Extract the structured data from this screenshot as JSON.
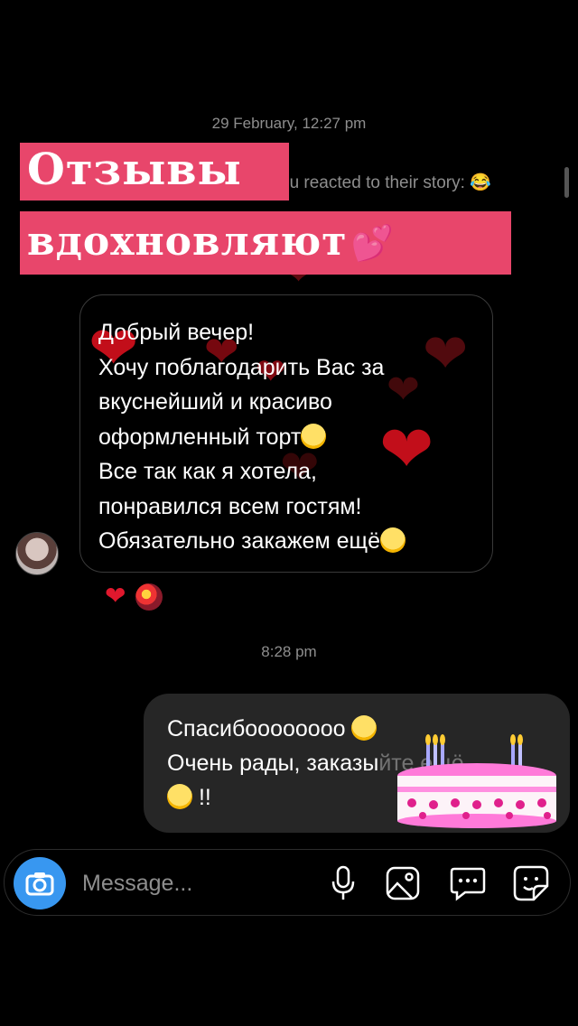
{
  "thread": {
    "date_stamp": "29 February, 12:27 pm",
    "reaction_note": "ou reacted to their story: 😂",
    "time_stamp": "8:28 pm"
  },
  "overlay": {
    "line1": "Отзывы",
    "line2": "вдохновляют",
    "color": "#e8466b"
  },
  "incoming_message": {
    "lines": [
      "Добрый вечер!",
      "Хочу поблагодарить Вас за",
      "вкуснейший и красиво",
      "оформленный торт",
      "Все так как я хотела,",
      "понравился всем гостям!",
      "Обязательно закажем ещё"
    ],
    "reactions": [
      "heart",
      "sticker"
    ]
  },
  "outgoing_message": {
    "line1": "Спасибоооооооо",
    "line2": "Очень рады, заказы",
    "line2_tail": "йте ещё",
    "line3": "!!"
  },
  "composer": {
    "placeholder": "Message...",
    "icons": [
      "camera-icon",
      "microphone-icon",
      "gallery-icon",
      "chat-bubble-icon",
      "sticker-icon"
    ],
    "accent": "#3897f0"
  }
}
